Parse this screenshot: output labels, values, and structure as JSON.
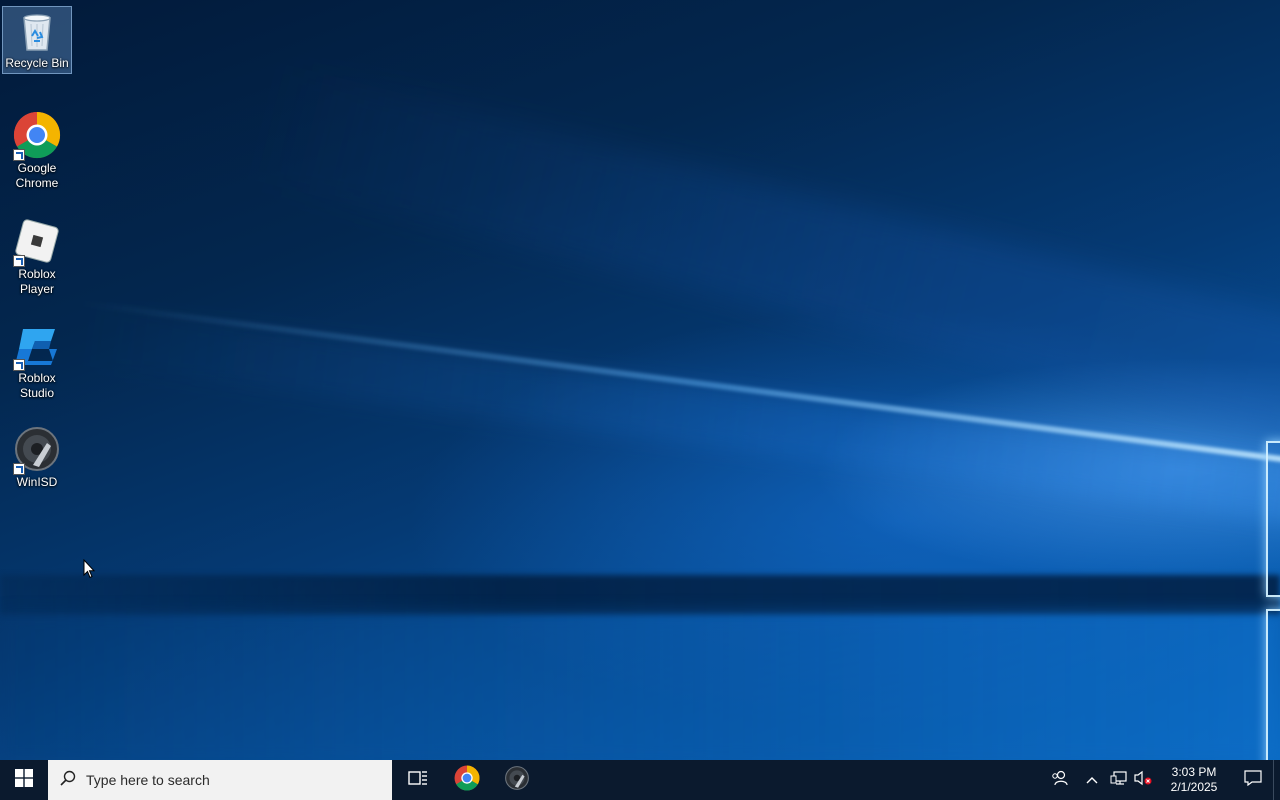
{
  "desktop": {
    "icons": [
      {
        "label": "Recycle Bin",
        "icon": "recycle-bin-icon",
        "selected": true
      },
      {
        "label": "Google Chrome",
        "icon": "chrome-icon"
      },
      {
        "label": "Roblox Player",
        "icon": "roblox-player-icon"
      },
      {
        "label": "Roblox Studio",
        "icon": "roblox-studio-icon"
      },
      {
        "label": "WinISD",
        "icon": "winisd-icon"
      }
    ]
  },
  "taskbar": {
    "start_icon": "windows-start-icon",
    "search_placeholder": "Type here to search",
    "pinned_apps": [
      "task-view-icon",
      "chrome-icon",
      "winisd-icon"
    ],
    "tray_icons": [
      "people-icon",
      "chevron-up-icon",
      "network-icon",
      "volume-muted-icon"
    ],
    "clock": {
      "time": "3:03 PM",
      "date": "2/1/2025"
    }
  },
  "colors": {
    "taskbar_bg": "#0b1a2e",
    "search_bg": "#f2f2f2",
    "accent": "#0a6bc4"
  }
}
